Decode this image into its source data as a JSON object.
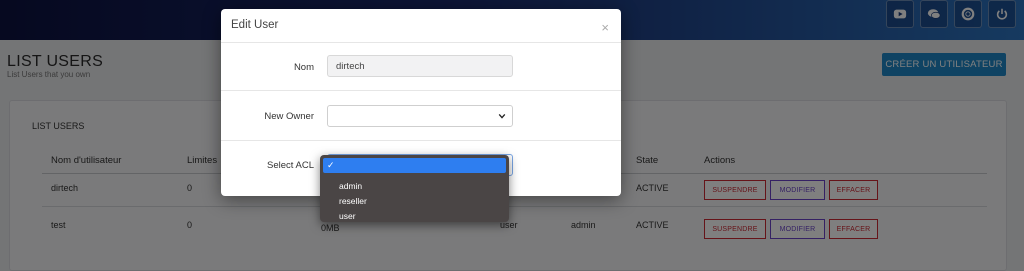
{
  "page": {
    "title": "LIST USERS",
    "subtitle": "List Users that you own",
    "create_button": "CRÉER UN UTILISATEUR"
  },
  "topbar": {
    "icons": [
      "youtube-icon",
      "chat-icon",
      "lifebuoy-icon",
      "power-icon"
    ]
  },
  "table": {
    "card_title": "LIST USERS",
    "headers": {
      "username": "Nom d'utilisateur",
      "limits": "Limites",
      "state": "State",
      "actions": "Actions"
    },
    "rows": [
      {
        "username": "dirtech",
        "limits": "0",
        "state": "ACTIVE"
      },
      {
        "username": "test",
        "limits": "0",
        "col3": "0MB",
        "col4": "user",
        "owner": "admin",
        "state": "ACTIVE"
      }
    ],
    "action_labels": {
      "suspend": "SUSPENDRE",
      "modify": "MODIFIER",
      "delete": "EFFACER"
    }
  },
  "modal": {
    "title": "Edit User",
    "close": "×",
    "nom_label": "Nom",
    "nom_value": "dirtech",
    "owner_label": "New Owner",
    "acl_label": "Select ACL"
  },
  "dropdown": {
    "options": [
      {
        "label": "",
        "selected": true,
        "check": "✓"
      },
      {
        "label": "admin"
      },
      {
        "label": "reseller"
      },
      {
        "label": "user"
      }
    ]
  },
  "colors": {
    "accent": "#1e87c7",
    "danger": "#cc2833",
    "modify": "#6a43c9",
    "select_highlight": "#2e7ef0"
  }
}
